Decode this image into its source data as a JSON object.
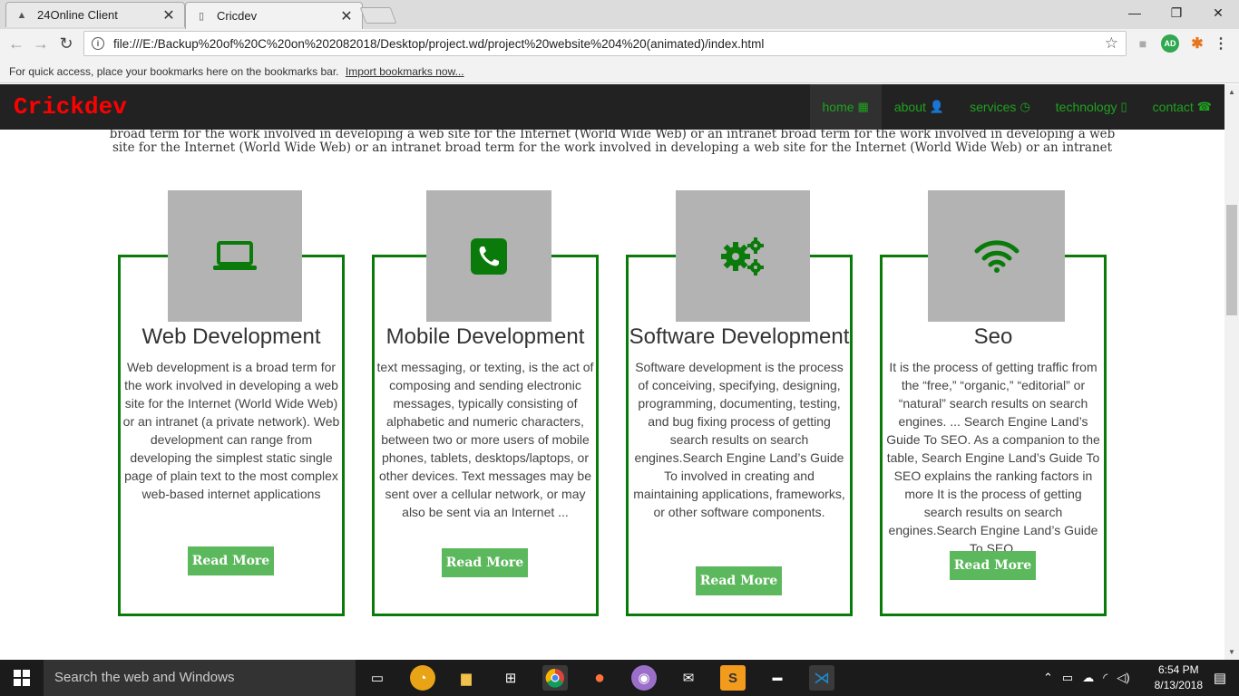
{
  "browser": {
    "tabs": [
      {
        "title": "24Online Client",
        "icon": "24online-favicon"
      },
      {
        "title": "Cricdev",
        "icon": "page-icon"
      }
    ],
    "tab_close_glyph": "✕",
    "window_controls": {
      "minimize": "—",
      "maximize": "❐",
      "close": "✕"
    },
    "url": "file:///E:/Backup%20of%20C%20on%202082018/Desktop/project.wd/project%20website%204%20(animated)/index.html",
    "bookmarks_bar": {
      "message": "For quick access, place your bookmarks here on the bookmarks bar.",
      "import_link": "Import bookmarks now..."
    },
    "extensions": [
      {
        "name": "camera-icon"
      },
      {
        "name": "adblock-icon",
        "label": "AD",
        "color": "#2fa84f"
      },
      {
        "name": "extension-icon",
        "color": "#e8741c"
      }
    ]
  },
  "site": {
    "brand": "Crickdev",
    "nav": [
      {
        "label": "home",
        "icon": "▦",
        "active": true
      },
      {
        "label": "about",
        "icon": "👤",
        "active": false
      },
      {
        "label": "services",
        "icon": "◷",
        "active": false
      },
      {
        "label": "technology",
        "icon": "▯",
        "active": false
      },
      {
        "label": "contact",
        "icon": "☎",
        "active": false
      }
    ],
    "intro_lines": [
      "broad term for the work involved in developing a web site for the Internet (World Wide Web) or an intranet broad term for the work involved in developing a web",
      "site for the Internet (World Wide Web) or an intranet broad term for the work involved in developing a web site for the Internet (World Wide Web) or an intranet"
    ],
    "accent": "#0a7a0a",
    "button_color": "#5cb85c",
    "cards": [
      {
        "title": "Web Development",
        "icon": "laptop-icon",
        "text": "Web development is a broad term for the work involved in developing a web site for the Internet (World Wide Web) or an intranet (a private network). Web development can range from developing the simplest static single page of plain text to the most complex web-based internet applications",
        "button": "Read More"
      },
      {
        "title": "Mobile Development",
        "icon": "phone-icon",
        "text": "text messaging, or texting, is the act of composing and sending electronic messages, typically consisting of alphabetic and numeric characters, between two or more users of mobile phones, tablets, desktops/laptops, or other devices. Text messages may be sent over a cellular network, or may also be sent via an Internet ...",
        "button": "Read More"
      },
      {
        "title": "Software Development",
        "icon": "gears-icon",
        "text": "Software development is the process of conceiving, specifying, designing, programming, documenting, testing, and bug fixing process of getting search results on search engines.Search Engine Land’s Guide To involved in creating and maintaining applications, frameworks, or other software components.",
        "button": "Read More"
      },
      {
        "title": "Seo",
        "icon": "wifi-icon",
        "text": "It is the process of getting traffic from the “free,” “organic,” “editorial” or “natural” search results on search engines. ... Search Engine Land’s Guide To SEO. As a companion to the table, Search Engine Land’s Guide To SEO explains the ranking factors in more It is the process of getting search results on search engines.Search Engine Land’s Guide To SEO.",
        "button": "Read More"
      }
    ]
  },
  "taskbar": {
    "search_placeholder": "Search the web and Windows",
    "apps": [
      "task-view-icon",
      "avast-icon",
      "file-explorer-icon",
      "store-icon",
      "chrome-icon",
      "firefox-icon",
      "github-icon",
      "mail-icon",
      "sublime-icon",
      "cmd-icon",
      "vscode-icon"
    ],
    "time": "6:54 PM",
    "date": "8/13/2018"
  }
}
